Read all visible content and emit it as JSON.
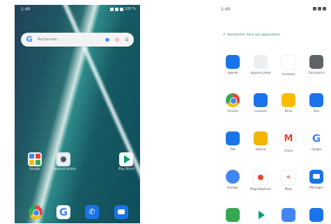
{
  "home": {
    "status": {
      "time": "1:40",
      "battery": "100 %"
    },
    "search": {
      "placeholder": "Rechercher"
    },
    "apps": [
      {
        "name": "Google"
      },
      {
        "name": "Appareil photo"
      },
      {
        "name": "Play Store"
      }
    ],
    "dock": [
      "Chrome",
      "Google",
      "Téléphone",
      "Messages"
    ]
  },
  "drawer": {
    "status": {
      "time": "1:40"
    },
    "search_placeholder": "Rechercher dans vos applications",
    "rows": [
      [
        {
          "label": "Agenda",
          "color": "#1a73e8",
          "icon": "calendar-icon"
        },
        {
          "label": "Appareil photo",
          "color": "#eceff1",
          "icon": "camera-icon"
        },
        {
          "label": "Assistant",
          "color": "#ffffff",
          "icon": "assistant-icon"
        },
        {
          "label": "Calculatrice",
          "color": "#5f6368",
          "icon": "calculator-icon"
        }
      ],
      [
        {
          "label": "Chrome",
          "color": "#ea4335",
          "icon": "chrome-icon"
        },
        {
          "label": "Contacts",
          "color": "#1a73e8",
          "icon": "contacts-icon"
        },
        {
          "label": "Drive",
          "color": "#fbbc05",
          "icon": "drive-icon"
        },
        {
          "label": "Duo",
          "color": "#1a73e8",
          "icon": "duo-icon"
        }
      ],
      [
        {
          "label": "Files",
          "color": "#1a73e8",
          "icon": "files-icon"
        },
        {
          "label": "Galerie",
          "color": "#f4b400",
          "icon": "gallery-icon"
        },
        {
          "label": "Gmail",
          "color": "#ffffff",
          "icon": "gmail-icon"
        },
        {
          "label": "Google",
          "color": "#ffffff",
          "icon": "google-icon"
        }
      ],
      [
        {
          "label": "Horloge",
          "color": "#4285f4",
          "icon": "clock-icon"
        },
        {
          "label": "Magnétophone",
          "color": "#ea4335",
          "icon": "recorder-icon"
        },
        {
          "label": "Maps",
          "color": "#34a853",
          "icon": "maps-icon"
        },
        {
          "label": "Messages",
          "color": "#1a73e8",
          "icon": "messages-icon"
        }
      ],
      [
        {
          "label": "",
          "color": "#34a853",
          "icon": "partial-icon"
        },
        {
          "label": "",
          "color": "#00a173",
          "icon": "play-icon"
        },
        {
          "label": "",
          "color": "#4285f4",
          "icon": "partial-icon"
        },
        {
          "label": "",
          "color": "#1a73e8",
          "icon": "partial-icon"
        }
      ]
    ]
  }
}
